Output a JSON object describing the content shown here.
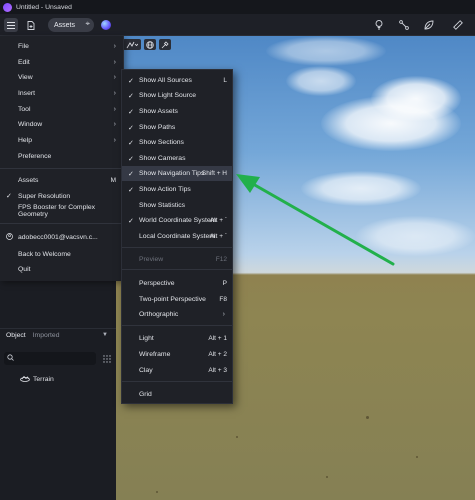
{
  "window": {
    "title": "Untitled - Unsaved"
  },
  "toolbar": {
    "assets_label": "Assets",
    "icons": [
      "menu-icon",
      "new-file-icon",
      "pin-icon",
      "orb-icon",
      "lightbulb-icon",
      "pen-tool-icon",
      "leaf-icon",
      "ruler-icon"
    ]
  },
  "main_menu": {
    "items": [
      {
        "label": "File",
        "submenu": true
      },
      {
        "label": "Edit",
        "submenu": true
      },
      {
        "label": "View",
        "submenu": true
      },
      {
        "label": "Insert",
        "submenu": true
      },
      {
        "label": "Tool",
        "submenu": true
      },
      {
        "label": "Window",
        "submenu": true
      },
      {
        "label": "Help",
        "submenu": true
      },
      {
        "label": "Preference",
        "submenu": false
      }
    ],
    "assets": {
      "label": "Assets",
      "shortcut": "M"
    },
    "super_resolution": "Super Resolution",
    "fps_booster": "FPS Booster for Complex Geometry",
    "account": "adobecc0001@vacsvn.c...",
    "back_to_welcome": "Back to Welcome",
    "quit": "Quit"
  },
  "view_menu": {
    "items": [
      {
        "label": "Show All Sources",
        "checked": true,
        "shortcut": "L"
      },
      {
        "label": "Show Light Source",
        "checked": true,
        "shortcut": ""
      },
      {
        "label": "Show Assets",
        "checked": true,
        "shortcut": ""
      },
      {
        "label": "Show Paths",
        "checked": true,
        "shortcut": ""
      },
      {
        "label": "Show Sections",
        "checked": true,
        "shortcut": ""
      },
      {
        "label": "Show Cameras",
        "checked": true,
        "shortcut": ""
      },
      {
        "label": "Show Navigation Tips",
        "checked": true,
        "shortcut": "Shift + H",
        "highlighted": true
      },
      {
        "label": "Show Action Tips",
        "checked": true,
        "shortcut": ""
      },
      {
        "label": "Show Statistics",
        "checked": false,
        "shortcut": ""
      },
      {
        "label": "World Coordinate System",
        "checked": true,
        "shortcut": "Alt + `"
      },
      {
        "label": "Local Coordinate System",
        "checked": false,
        "shortcut": "Alt + `"
      }
    ],
    "preview": {
      "label": "Preview",
      "shortcut": "F12"
    },
    "perspective": {
      "label": "Perspective",
      "shortcut": "P"
    },
    "two_point": {
      "label": "Two-point Perspective",
      "shortcut": "F8"
    },
    "orthographic": {
      "label": "Orthographic"
    },
    "light": {
      "label": "Light",
      "shortcut": "Alt + 1"
    },
    "wireframe": {
      "label": "Wireframe",
      "shortcut": "Alt + 2"
    },
    "clay": {
      "label": "Clay",
      "shortcut": "Alt + 3"
    },
    "grid": {
      "label": "Grid"
    }
  },
  "panel": {
    "tabs": [
      "Object",
      "Imported"
    ],
    "active_tab": "Object",
    "search_placeholder": "",
    "tree": [
      {
        "label": "Terrain",
        "icon": "terrain-icon"
      }
    ]
  },
  "colors": {
    "accent_arrow": "#22b04b",
    "menu_bg": "#1f2127",
    "highlight": "#353945"
  }
}
